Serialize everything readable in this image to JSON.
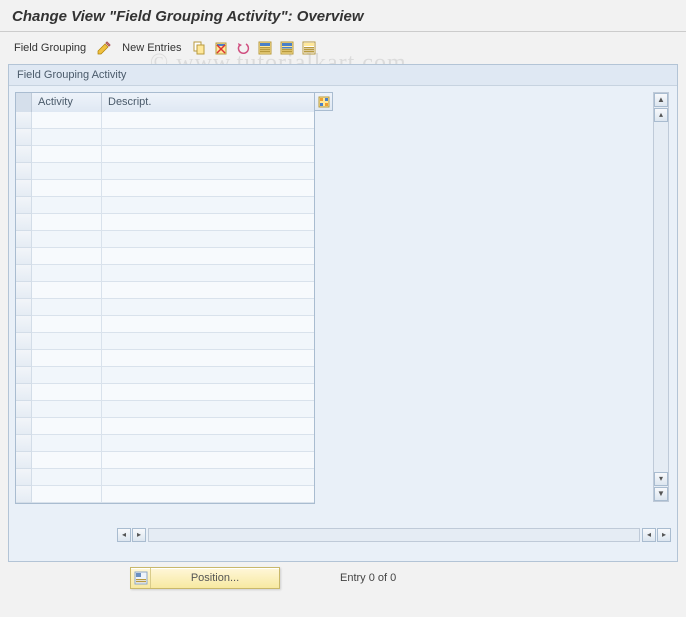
{
  "page_title": "Change View \"Field Grouping Activity\": Overview",
  "toolbar": {
    "field_grouping_label": "Field Grouping",
    "new_entries_label": "New Entries"
  },
  "icons": {
    "pencil": "pencil-icon",
    "copy": "copy-icon",
    "delete": "delete-icon",
    "undo": "undo-icon",
    "select_all": "select-all-icon",
    "select_block": "select-block-icon",
    "deselect_all": "deselect-all-icon"
  },
  "panel": {
    "title": "Field Grouping Activity"
  },
  "table": {
    "headers": {
      "activity": "Activity",
      "descript": "Descript."
    },
    "rows": [
      {
        "activity": "",
        "descript": ""
      },
      {
        "activity": "",
        "descript": ""
      },
      {
        "activity": "",
        "descript": ""
      },
      {
        "activity": "",
        "descript": ""
      },
      {
        "activity": "",
        "descript": ""
      },
      {
        "activity": "",
        "descript": ""
      },
      {
        "activity": "",
        "descript": ""
      },
      {
        "activity": "",
        "descript": ""
      },
      {
        "activity": "",
        "descript": ""
      },
      {
        "activity": "",
        "descript": ""
      },
      {
        "activity": "",
        "descript": ""
      },
      {
        "activity": "",
        "descript": ""
      },
      {
        "activity": "",
        "descript": ""
      },
      {
        "activity": "",
        "descript": ""
      },
      {
        "activity": "",
        "descript": ""
      },
      {
        "activity": "",
        "descript": ""
      },
      {
        "activity": "",
        "descript": ""
      },
      {
        "activity": "",
        "descript": ""
      },
      {
        "activity": "",
        "descript": ""
      },
      {
        "activity": "",
        "descript": ""
      },
      {
        "activity": "",
        "descript": ""
      },
      {
        "activity": "",
        "descript": ""
      },
      {
        "activity": "",
        "descript": ""
      }
    ]
  },
  "footer": {
    "position_label": "Position...",
    "entry_text": "Entry 0 of 0"
  },
  "watermark": "© www.tutorialkart.com"
}
